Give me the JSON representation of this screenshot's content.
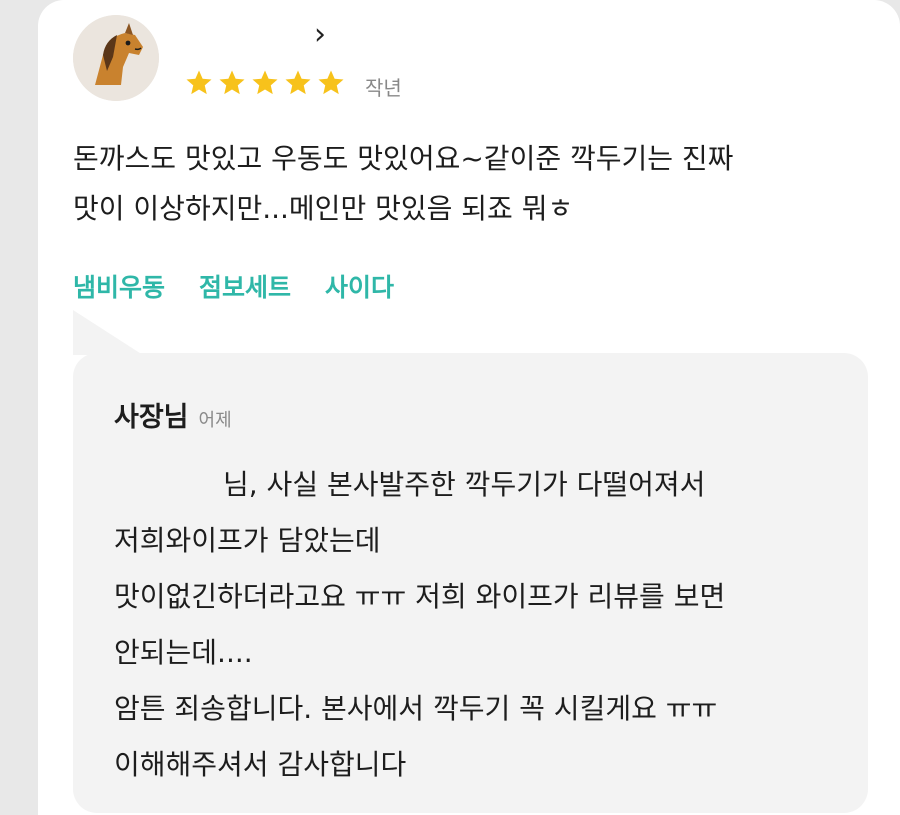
{
  "review": {
    "date": "작년",
    "rating": 5,
    "text_lines": [
      "돈까스도 맛있고 우동도 맛있어요~같이준 깍두기는 진짜",
      "맛이 이상하지만...메인만 맛있음 되죠 뭐ㅎ"
    ],
    "tags": [
      "냄비우동",
      "점보세트",
      "사이다"
    ]
  },
  "reply": {
    "owner_label": "사장님",
    "date": "어제",
    "lines": [
      "님, 사실 본사발주한 깍두기가 다떨어져서",
      "저희와이프가 담았는데",
      "맛이없긴하더라고요 ㅠㅠ 저희 와이프가 리뷰를 보면",
      "안되는데....",
      "암튼 죄송합니다. 본사에서 깍두기 꼭 시킬게요 ㅠㅠ",
      "이해해주셔서 감사합니다"
    ]
  },
  "colors": {
    "star": "#f7c21b",
    "tag": "#2fb7a8",
    "reply_bg": "#f3f3f3"
  },
  "icons": {
    "avatar": "horse-avatar-icon",
    "profile_link": "chevron-right-icon",
    "rating": "star-icon"
  }
}
